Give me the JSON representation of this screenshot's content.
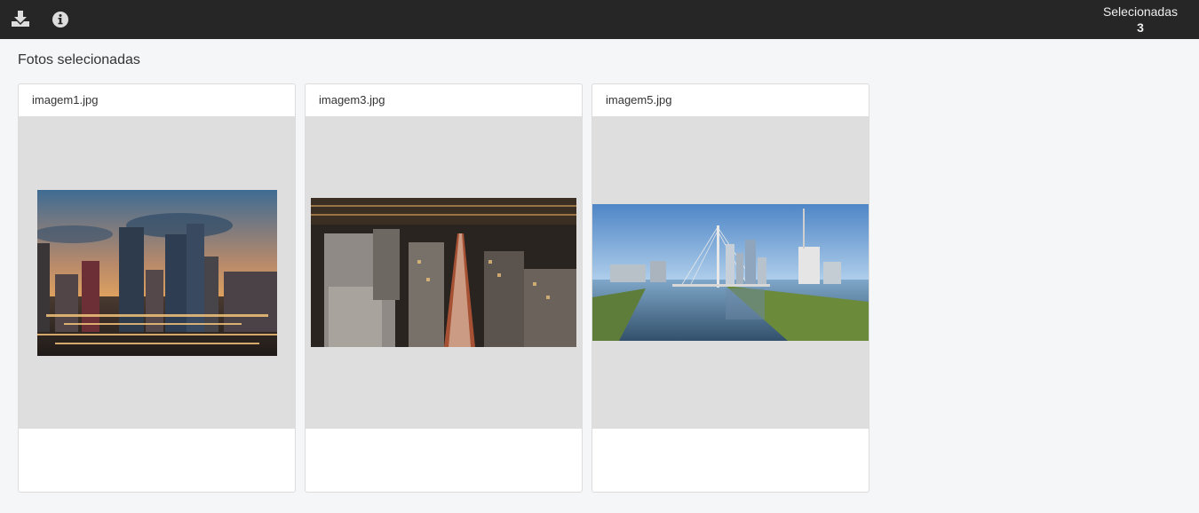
{
  "toolbar": {
    "download_icon": "download-icon",
    "info_icon": "info-icon",
    "selected_label": "Selecionadas",
    "selected_count": "3"
  },
  "section": {
    "title": "Fotos selecionadas"
  },
  "photos": [
    {
      "name": "imagem1.jpg",
      "subject": "city skyline at dusk"
    },
    {
      "name": "imagem3.jpg",
      "subject": "city avenue at night, aerial"
    },
    {
      "name": "imagem5.jpg",
      "subject": "cable-stayed bridge over river"
    }
  ],
  "colors": {
    "topbar": "#262626",
    "page_bg": "#f5f6f8",
    "media_bg": "#dedede"
  }
}
